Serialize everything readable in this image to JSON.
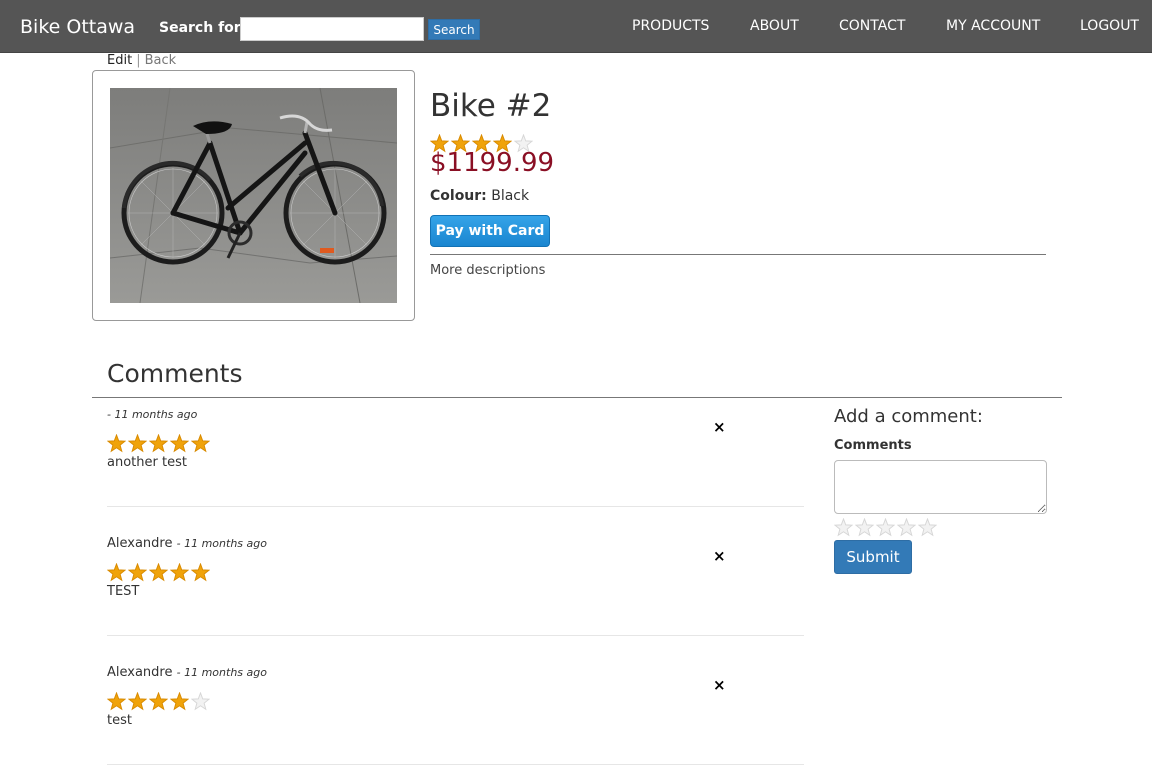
{
  "nav": {
    "brand": "Bike Ottawa",
    "search_label": "Search for:",
    "search_value": "",
    "search_button": "Search",
    "links": [
      "PRODUCTS",
      "ABOUT",
      "CONTACT",
      "MY ACCOUNT",
      "LOGOUT"
    ]
  },
  "breadcrumb": {
    "edit": "Edit",
    "separator": "|",
    "back": "Back"
  },
  "product": {
    "title": "Bike #2",
    "rating": 4,
    "max_rating": 5,
    "price": "$1199.99",
    "colour_label": "Colour:",
    "colour_value": "Black",
    "pay_button": "Pay with Card",
    "more_descriptions": "More descriptions"
  },
  "comments_section": {
    "heading": "Comments",
    "delete_icon": "×",
    "items": [
      {
        "author": "",
        "time": "- 11 months ago",
        "rating": 5,
        "text": "another test"
      },
      {
        "author": "Alexandre",
        "time": "- 11 months ago",
        "rating": 5,
        "text": "TEST"
      },
      {
        "author": "Alexandre",
        "time": "- 11 months ago",
        "rating": 4,
        "text": "test"
      }
    ]
  },
  "add_comment": {
    "title": "Add a comment:",
    "label": "Comments",
    "value": "",
    "rating": 0,
    "submit": "Submit"
  },
  "colors": {
    "star_filled": "#f0a30a",
    "star_empty": "#d6d6d6",
    "nav_bg": "#555555",
    "price": "#8a0f24",
    "primary": "#337ab7"
  }
}
